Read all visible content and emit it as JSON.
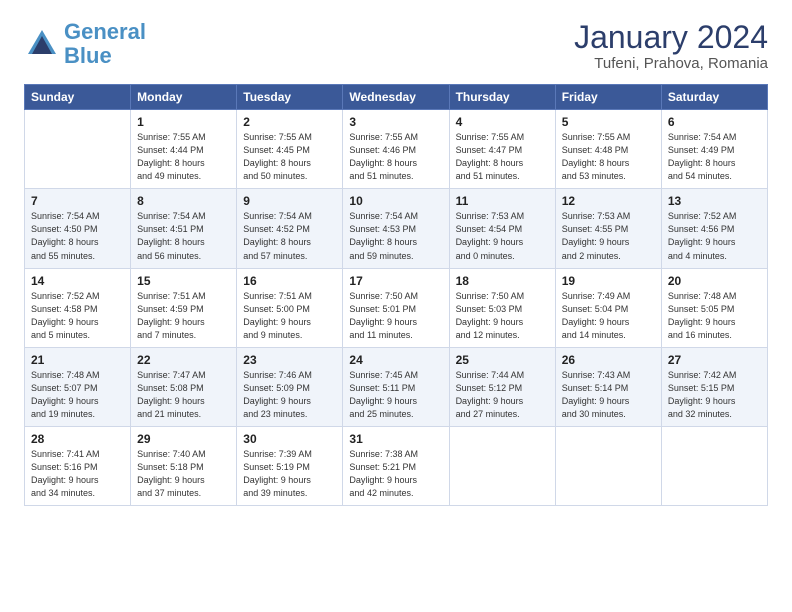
{
  "header": {
    "logo_line1": "General",
    "logo_line2": "Blue",
    "title": "January 2024",
    "subtitle": "Tufeni, Prahova, Romania"
  },
  "days_of_week": [
    "Sunday",
    "Monday",
    "Tuesday",
    "Wednesday",
    "Thursday",
    "Friday",
    "Saturday"
  ],
  "weeks": [
    [
      {
        "day": "",
        "info": ""
      },
      {
        "day": "1",
        "info": "Sunrise: 7:55 AM\nSunset: 4:44 PM\nDaylight: 8 hours\nand 49 minutes."
      },
      {
        "day": "2",
        "info": "Sunrise: 7:55 AM\nSunset: 4:45 PM\nDaylight: 8 hours\nand 50 minutes."
      },
      {
        "day": "3",
        "info": "Sunrise: 7:55 AM\nSunset: 4:46 PM\nDaylight: 8 hours\nand 51 minutes."
      },
      {
        "day": "4",
        "info": "Sunrise: 7:55 AM\nSunset: 4:47 PM\nDaylight: 8 hours\nand 51 minutes."
      },
      {
        "day": "5",
        "info": "Sunrise: 7:55 AM\nSunset: 4:48 PM\nDaylight: 8 hours\nand 53 minutes."
      },
      {
        "day": "6",
        "info": "Sunrise: 7:54 AM\nSunset: 4:49 PM\nDaylight: 8 hours\nand 54 minutes."
      }
    ],
    [
      {
        "day": "7",
        "info": "Sunrise: 7:54 AM\nSunset: 4:50 PM\nDaylight: 8 hours\nand 55 minutes."
      },
      {
        "day": "8",
        "info": "Sunrise: 7:54 AM\nSunset: 4:51 PM\nDaylight: 8 hours\nand 56 minutes."
      },
      {
        "day": "9",
        "info": "Sunrise: 7:54 AM\nSunset: 4:52 PM\nDaylight: 8 hours\nand 57 minutes."
      },
      {
        "day": "10",
        "info": "Sunrise: 7:54 AM\nSunset: 4:53 PM\nDaylight: 8 hours\nand 59 minutes."
      },
      {
        "day": "11",
        "info": "Sunrise: 7:53 AM\nSunset: 4:54 PM\nDaylight: 9 hours\nand 0 minutes."
      },
      {
        "day": "12",
        "info": "Sunrise: 7:53 AM\nSunset: 4:55 PM\nDaylight: 9 hours\nand 2 minutes."
      },
      {
        "day": "13",
        "info": "Sunrise: 7:52 AM\nSunset: 4:56 PM\nDaylight: 9 hours\nand 4 minutes."
      }
    ],
    [
      {
        "day": "14",
        "info": "Sunrise: 7:52 AM\nSunset: 4:58 PM\nDaylight: 9 hours\nand 5 minutes."
      },
      {
        "day": "15",
        "info": "Sunrise: 7:51 AM\nSunset: 4:59 PM\nDaylight: 9 hours\nand 7 minutes."
      },
      {
        "day": "16",
        "info": "Sunrise: 7:51 AM\nSunset: 5:00 PM\nDaylight: 9 hours\nand 9 minutes."
      },
      {
        "day": "17",
        "info": "Sunrise: 7:50 AM\nSunset: 5:01 PM\nDaylight: 9 hours\nand 11 minutes."
      },
      {
        "day": "18",
        "info": "Sunrise: 7:50 AM\nSunset: 5:03 PM\nDaylight: 9 hours\nand 12 minutes."
      },
      {
        "day": "19",
        "info": "Sunrise: 7:49 AM\nSunset: 5:04 PM\nDaylight: 9 hours\nand 14 minutes."
      },
      {
        "day": "20",
        "info": "Sunrise: 7:48 AM\nSunset: 5:05 PM\nDaylight: 9 hours\nand 16 minutes."
      }
    ],
    [
      {
        "day": "21",
        "info": "Sunrise: 7:48 AM\nSunset: 5:07 PM\nDaylight: 9 hours\nand 19 minutes."
      },
      {
        "day": "22",
        "info": "Sunrise: 7:47 AM\nSunset: 5:08 PM\nDaylight: 9 hours\nand 21 minutes."
      },
      {
        "day": "23",
        "info": "Sunrise: 7:46 AM\nSunset: 5:09 PM\nDaylight: 9 hours\nand 23 minutes."
      },
      {
        "day": "24",
        "info": "Sunrise: 7:45 AM\nSunset: 5:11 PM\nDaylight: 9 hours\nand 25 minutes."
      },
      {
        "day": "25",
        "info": "Sunrise: 7:44 AM\nSunset: 5:12 PM\nDaylight: 9 hours\nand 27 minutes."
      },
      {
        "day": "26",
        "info": "Sunrise: 7:43 AM\nSunset: 5:14 PM\nDaylight: 9 hours\nand 30 minutes."
      },
      {
        "day": "27",
        "info": "Sunrise: 7:42 AM\nSunset: 5:15 PM\nDaylight: 9 hours\nand 32 minutes."
      }
    ],
    [
      {
        "day": "28",
        "info": "Sunrise: 7:41 AM\nSunset: 5:16 PM\nDaylight: 9 hours\nand 34 minutes."
      },
      {
        "day": "29",
        "info": "Sunrise: 7:40 AM\nSunset: 5:18 PM\nDaylight: 9 hours\nand 37 minutes."
      },
      {
        "day": "30",
        "info": "Sunrise: 7:39 AM\nSunset: 5:19 PM\nDaylight: 9 hours\nand 39 minutes."
      },
      {
        "day": "31",
        "info": "Sunrise: 7:38 AM\nSunset: 5:21 PM\nDaylight: 9 hours\nand 42 minutes."
      },
      {
        "day": "",
        "info": ""
      },
      {
        "day": "",
        "info": ""
      },
      {
        "day": "",
        "info": ""
      }
    ]
  ]
}
